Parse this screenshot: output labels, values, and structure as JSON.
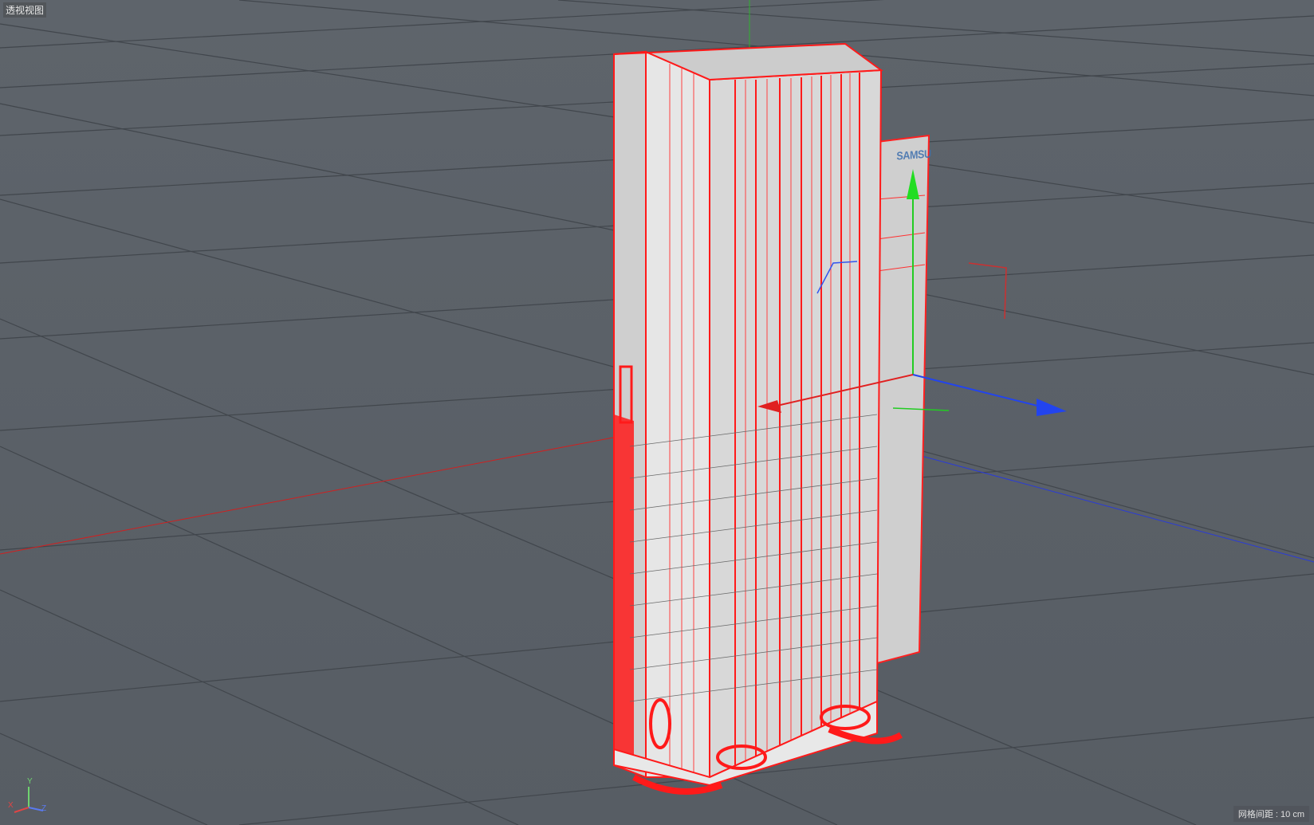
{
  "viewport": {
    "label": "透视视图",
    "grid_spacing": "网格间距 : 10 cm",
    "object_logo_text": "SAMSU"
  },
  "axis_gizmo": {
    "y": "Y",
    "x": "X",
    "z": "Z"
  },
  "colors": {
    "background": "#5a6068",
    "grid_line": "#3f444a",
    "wireframe": "#ff1a1a",
    "model_surface": "#d8d8d8",
    "axis_x": "#e02020",
    "axis_y": "#22cc22",
    "axis_z": "#2244ee"
  },
  "icons": [
    "move-gizmo-y-arrow-icon",
    "move-gizmo-z-arrow-icon",
    "move-gizmo-x-arrow-icon",
    "axis-orientation-icon"
  ]
}
